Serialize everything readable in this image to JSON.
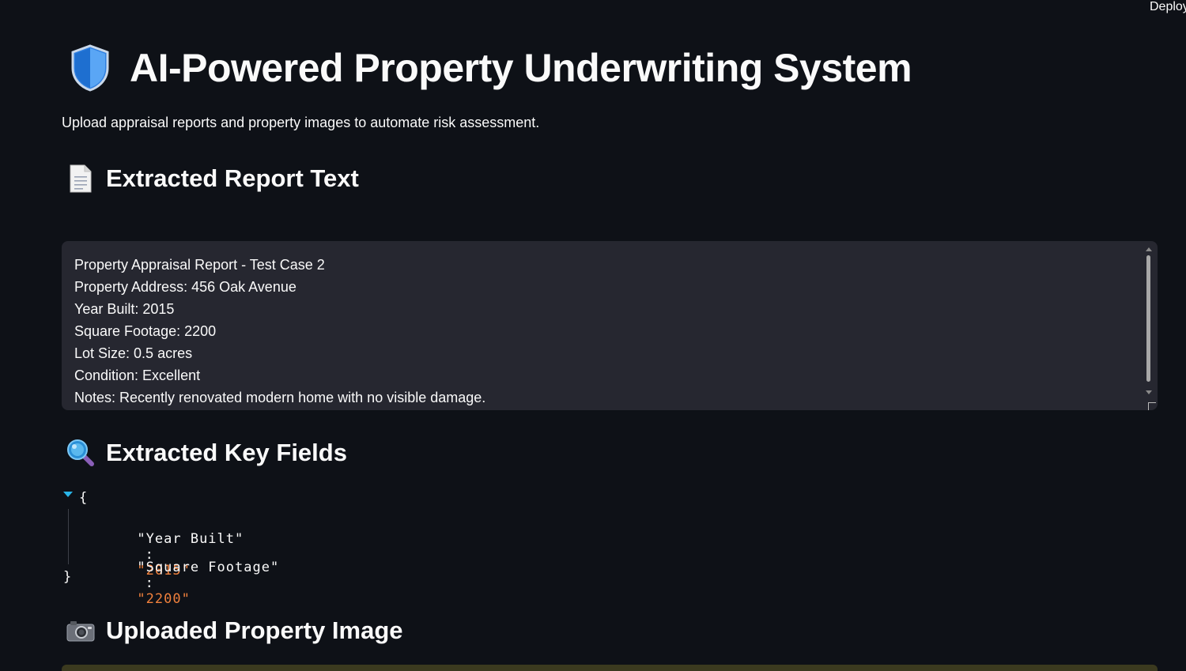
{
  "header": {
    "deploy_label": "Deploy"
  },
  "page": {
    "title": "AI-Powered Property Underwriting System",
    "title_icon": "shield-icon",
    "subtitle": "Upload appraisal reports and property images to automate risk assessment."
  },
  "sections": {
    "report_text": {
      "heading": "Extracted Report Text",
      "icon": "document-icon",
      "lines": [
        "Property Appraisal Report - Test Case 2",
        "Property Address: 456 Oak Avenue",
        "Year Built: 2015",
        "Square Footage: 2200",
        "Lot Size: 0.5 acres",
        "Condition: Excellent",
        "Notes: Recently renovated modern home with no visible damage."
      ]
    },
    "key_fields": {
      "heading": "Extracted Key Fields",
      "icon": "magnifying-glass-icon",
      "open_brace": "{",
      "close_brace": "}",
      "colon": ":",
      "fields": [
        {
          "key": "\"Year Built\"",
          "value": "\"2015\""
        },
        {
          "key": "\"Square Footage\"",
          "value": "\"2200\""
        }
      ]
    },
    "property_image": {
      "heading": "Uploaded Property Image",
      "icon": "camera-icon"
    }
  },
  "colors": {
    "background": "#0e1117",
    "text": "#fafafa",
    "textarea_bg": "#262730",
    "json_value": "#f0803c",
    "toggle_accent": "#29b5e8"
  }
}
